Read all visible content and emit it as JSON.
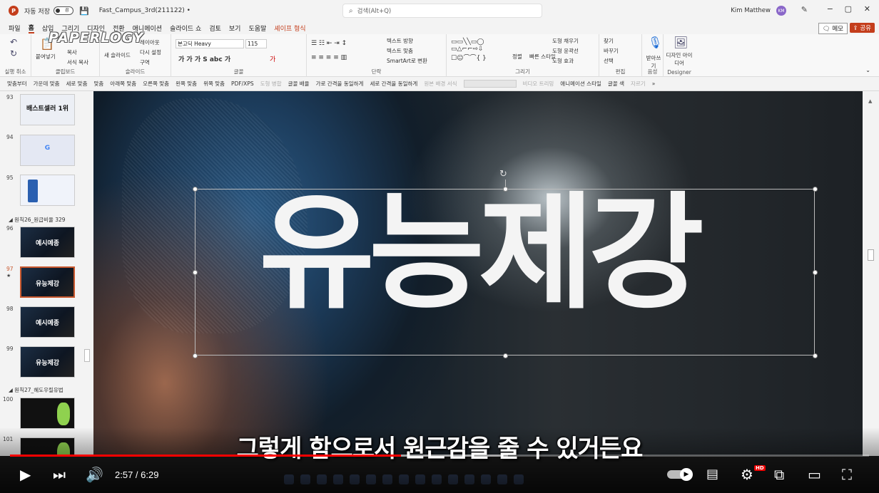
{
  "titlebar": {
    "app_icon": "P",
    "autosave_label": "자동 저장",
    "autosave_toggle": "끔",
    "filename": "Fast_Campus_3rd(211122) •",
    "search_placeholder": "검색(Alt+Q)",
    "user_name": "Kim Matthew",
    "user_initials": "KM",
    "minimize": "−",
    "maximize": "▢",
    "close": "✕"
  },
  "menu": {
    "tabs": [
      "파일",
      "홈",
      "삽입",
      "그리기",
      "디자인",
      "전환",
      "애니메이션",
      "슬라이드 쇼",
      "검토",
      "보기",
      "도움말",
      "셰이프 형식"
    ],
    "active_tab": "홈",
    "memo_label": "메모",
    "share_label": "공유"
  },
  "ribbon": {
    "groups": {
      "undo": "실행 취소",
      "clipboard": "클립보드",
      "slides": "슬라이드",
      "font": "글꼴",
      "paragraph": "단락",
      "drawing": "그리기",
      "editing": "편집",
      "voice": "음성",
      "designer": "Designer"
    },
    "clipboard_items": {
      "paste": "붙여넣기",
      "copy": "복사",
      "format_painter": "서식 복사"
    },
    "slides_items": {
      "new_slide": "새 슬라이드",
      "layout": "레이아웃",
      "reset": "다시 설정",
      "section": "구역"
    },
    "font_name": "본고딕 Heavy",
    "font_size": "115",
    "paragraph_items": {
      "text_direction": "텍스트 방향",
      "align_text": "텍스트 맞춤",
      "smartart": "SmartArt로 변환"
    },
    "drawing_items": {
      "arrange": "정렬",
      "quick_styles": "빠른 스타일",
      "shape_fill": "도형 채우기",
      "shape_outline": "도형 윤곽선",
      "shape_effects": "도형 효과"
    },
    "editing_items": {
      "find": "찾기",
      "replace": "바꾸기",
      "select": "선택"
    },
    "voice_items": {
      "dictate": "받아쓰기"
    },
    "designer_items": {
      "design_ideas": "디자인 아이디어"
    },
    "watermark": "PAPERLOGY"
  },
  "qat": {
    "items": [
      "맞춤부터",
      "가운데 맞춤",
      "세로 맞춤",
      "맞춤",
      "아래쪽 맞춤",
      "오른쪽 맞춤",
      "왼쪽 맞춤",
      "위쪽 맞춤",
      "PDF/XPS",
      "도형 병합",
      "글꼴 배율",
      "가로 간격을 동일하게",
      "세로 간격을 동일하게",
      "원본 배경 서식",
      "비디오 트리밍",
      "애니메이션 스타일",
      "글꼴 색",
      "자르기"
    ]
  },
  "thumbnails": {
    "slides": [
      {
        "num": "93",
        "label": "배스트셀러 1위",
        "style": "light-dark"
      },
      {
        "num": "94",
        "label": "G",
        "style": "light"
      },
      {
        "num": "95",
        "label": "",
        "style": "light"
      },
      {
        "num": "96",
        "label": "예시예종",
        "style": "dark"
      },
      {
        "num": "97",
        "label": "유능제강",
        "style": "dark"
      },
      {
        "num": "98",
        "label": "예시예종",
        "style": "dark"
      },
      {
        "num": "99",
        "label": "유능제강",
        "style": "dark"
      },
      {
        "num": "100",
        "label": "",
        "style": "black"
      },
      {
        "num": "101",
        "label": "",
        "style": "black"
      }
    ],
    "sections": [
      "원칙26_원급비율 329",
      "원칙27_혜도우릴유법"
    ],
    "selected_num": "97"
  },
  "slide": {
    "title": "유능제강"
  },
  "subtitle": "그렇게 함으로서 원근감을 줄 수 있거든요",
  "player": {
    "time_current": "2:57",
    "time_total": "6:29",
    "time_separator": " / ",
    "played_fraction": 0.455,
    "loaded_fraction": 0.58,
    "hd_badge": "HD",
    "colors": {
      "played": "#ff0000",
      "accent_ppt": "#c43e1c"
    }
  }
}
